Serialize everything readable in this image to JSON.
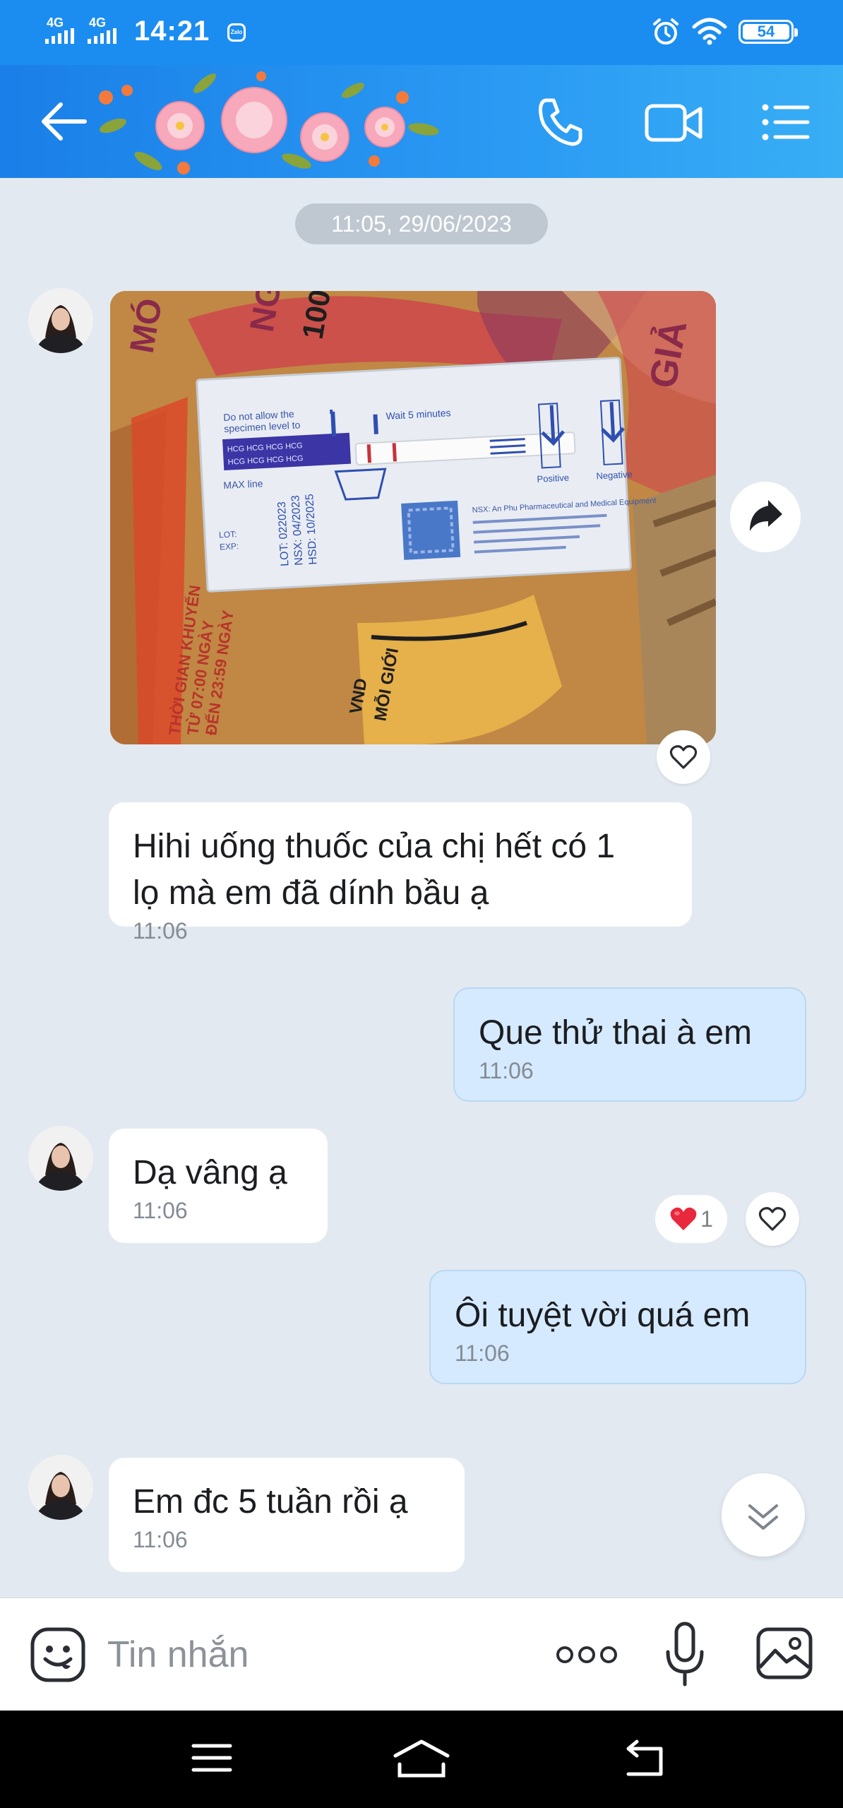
{
  "status_bar": {
    "network_1": "4G",
    "network_2": "4G",
    "time": "14:21",
    "zalo_badge": "Zalo",
    "battery": "54",
    "icons": [
      "alarm-icon",
      "wifi-icon",
      "battery-icon"
    ]
  },
  "header": {
    "icons": [
      "back-arrow-icon",
      "voice-call-icon",
      "video-call-icon",
      "options-menu-icon"
    ],
    "decoration": "flower-banner"
  },
  "chat": {
    "date_separator": "11:05, 29/06/2023",
    "messages": [
      {
        "side": "incoming",
        "type": "image",
        "content": "pregnancy test strip photo"
      },
      {
        "side": "incoming",
        "text": "Hihi uống thuốc của chị hết có 1\nlọ mà em đã dính bầu ạ",
        "time": "11:06"
      },
      {
        "side": "outgoing",
        "text": "Que thử thai à em",
        "time": "11:06"
      },
      {
        "side": "incoming",
        "text": "Dạ vâng ạ",
        "time": "11:06"
      },
      {
        "side": "outgoing",
        "text": "Ôi tuyệt vời quá em",
        "time": "11:06",
        "reaction_count": "1"
      },
      {
        "side": "incoming",
        "text": "Em đc 5 tuần rồi ạ",
        "time": "11:06"
      }
    ]
  },
  "photo_text": {
    "line_1": "Do not allow the",
    "line_2": "specimen level to",
    "max_line": "MAX line",
    "wait": "Wait 5 minutes",
    "positive": "Positive",
    "negative": "Negative",
    "lot": "LOT:",
    "exp": "EXP:",
    "lot_value": "LOT: 022023",
    "nsx_value": "NSX: 04/2023",
    "hsd_value": "HSD: 10/2025",
    "hcg": "HCG HCG HCG HCG",
    "mfr": "NSX: An Phu Pharmaceutical and Medical Equipment",
    "box_vnd": "VND",
    "box_moi_gioi": "MỖI GIỚI",
    "box_thoi_gian": "THỜI GIAN KHUYẾN",
    "box_tu": "TỪ 07:00 NGÀY",
    "box_den": "ĐẾN 23:59 NGÀY",
    "box_gia": "GIẢ",
    "box_mo": "MÓ",
    "box_100": "100",
    "box_ng": "NG"
  },
  "input_bar": {
    "placeholder": "Tin nhắn",
    "icons": [
      "emoji-icon",
      "more-options-icon",
      "microphone-icon",
      "gallery-icon"
    ]
  },
  "nav_bar": {
    "icons": [
      "recents-icon",
      "home-icon",
      "back-icon"
    ]
  },
  "colors": {
    "header_blue": "#1a7fe8",
    "chat_background": "#e2e9f1",
    "outgoing_bubble": "#d5eafe",
    "incoming_bubble": "#ffffff",
    "heart_red": "#e8283c"
  }
}
